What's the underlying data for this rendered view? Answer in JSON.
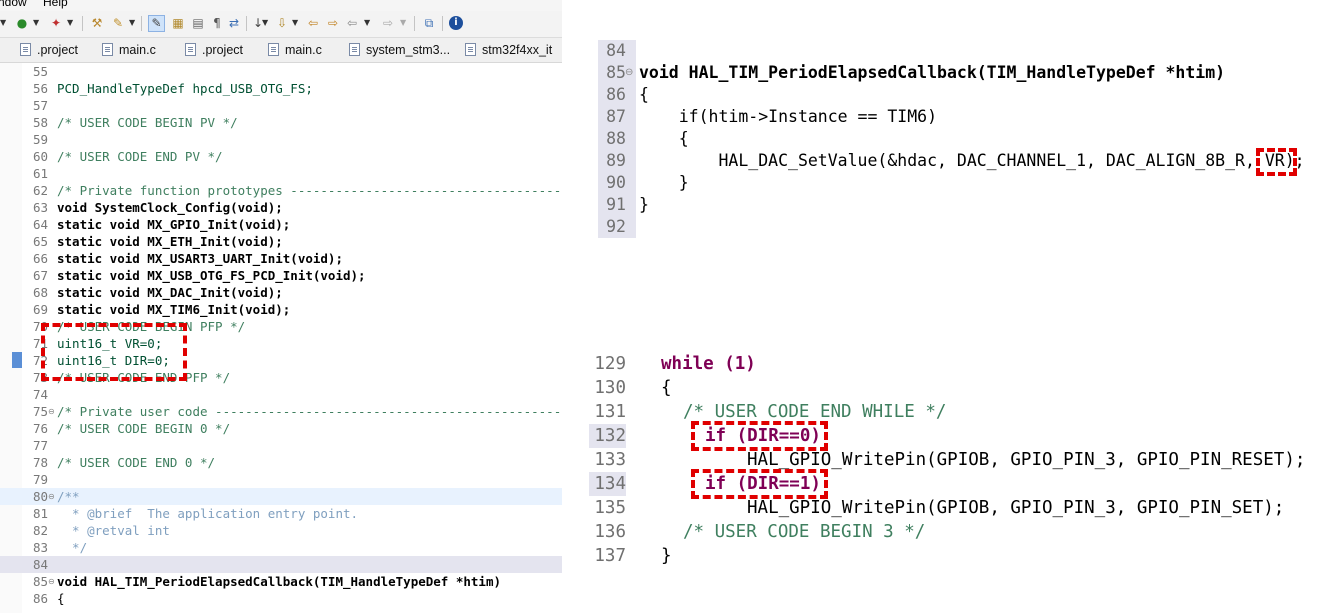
{
  "menubar": {
    "items": [
      "ndow",
      "Help"
    ]
  },
  "toolbar": {
    "icons": [
      "debug-dropdown-icon",
      "run-icon",
      "external-tools-icon",
      "build-icon",
      "toggle-mark-icon",
      "highlight-icon",
      "block-selection-icon",
      "show-whitespace-icon",
      "next-annotation-icon",
      "previous-annotation-icon",
      "back-icon",
      "forward-icon",
      "open-perspective-icon",
      "info-icon"
    ]
  },
  "tabs": [
    {
      "label": ".project"
    },
    {
      "label": "main.c"
    },
    {
      "label": ".project"
    },
    {
      "label": "main.c"
    },
    {
      "label": "system_stm3..."
    },
    {
      "label": "stm32f4xx_it"
    }
  ],
  "code": {
    "lines": [
      {
        "num": "55",
        "text": ""
      },
      {
        "num": "56",
        "text": "PCD_HandleTypeDef hpcd_USB_OTG_FS;"
      },
      {
        "num": "57",
        "text": ""
      },
      {
        "num": "58",
        "text": "/* USER CODE BEGIN PV */"
      },
      {
        "num": "59",
        "text": ""
      },
      {
        "num": "60",
        "text": "/* USER CODE END PV */"
      },
      {
        "num": "61",
        "text": ""
      },
      {
        "num": "62",
        "text": "/* Private function prototypes -----------------------------------------------"
      },
      {
        "num": "63",
        "text": "void SystemClock_Config(void);"
      },
      {
        "num": "64",
        "text": "static void MX_GPIO_Init(void);"
      },
      {
        "num": "65",
        "text": "static void MX_ETH_Init(void);"
      },
      {
        "num": "66",
        "text": "static void MX_USART3_UART_Init(void);"
      },
      {
        "num": "67",
        "text": "static void MX_USB_OTG_FS_PCD_Init(void);"
      },
      {
        "num": "68",
        "text": "static void MX_DAC_Init(void);"
      },
      {
        "num": "69",
        "text": "static void MX_TIM6_Init(void);"
      },
      {
        "num": "70",
        "text": "/* USER CODE BEGIN PFP */"
      },
      {
        "num": "71",
        "text": "uint16_t VR=0;"
      },
      {
        "num": "72",
        "text": "uint16_t DIR=0;"
      },
      {
        "num": "73",
        "text": "/* USER CODE END PFP */"
      },
      {
        "num": "74",
        "text": ""
      },
      {
        "num": "75",
        "text": "/* Private user code -----------------------------------------------"
      },
      {
        "num": "76",
        "text": "/* USER CODE BEGIN 0 */"
      },
      {
        "num": "77",
        "text": ""
      },
      {
        "num": "78",
        "text": "/* USER CODE END 0 */"
      },
      {
        "num": "79",
        "text": ""
      },
      {
        "num": "80",
        "text": "/**"
      },
      {
        "num": "81",
        "text": "  * @brief  The application entry point."
      },
      {
        "num": "82",
        "text": "  * @retval int"
      },
      {
        "num": "83",
        "text": "  */"
      },
      {
        "num": "84",
        "text": ""
      },
      {
        "num": "85",
        "text": "void HAL_TIM_PeriodElapsedCallback(TIM_HandleTypeDef *htim)"
      },
      {
        "num": "86",
        "text": "{"
      }
    ]
  },
  "snippet_callback": {
    "lines": [
      {
        "num": "84",
        "text": ""
      },
      {
        "num": "85",
        "text": "void HAL_TIM_PeriodElapsedCallback(TIM_HandleTypeDef *htim)"
      },
      {
        "num": "86",
        "text": "{"
      },
      {
        "num": "87",
        "text": "    if(htim->Instance == TIM6)"
      },
      {
        "num": "88",
        "text": "    {"
      },
      {
        "num": "89",
        "text": "        HAL_DAC_SetValue(&hdac, DAC_CHANNEL_1, DAC_ALIGN_8B_R, VR);"
      },
      {
        "num": "90",
        "text": "    }"
      },
      {
        "num": "91",
        "text": "}"
      },
      {
        "num": "92",
        "text": ""
      }
    ]
  },
  "snippet_while": {
    "lines": [
      {
        "num": "129",
        "text": "while (1)"
      },
      {
        "num": "130",
        "text": "{"
      },
      {
        "num": "131",
        "text": "/* USER CODE END WHILE */"
      },
      {
        "num": "132",
        "text": "if (DIR==0)"
      },
      {
        "num": "133",
        "text": "HAL_GPIO_WritePin(GPIOB, GPIO_PIN_3, GPIO_PIN_RESET);"
      },
      {
        "num": "134",
        "text": "if (DIR==1)"
      },
      {
        "num": "135",
        "text": "HAL_GPIO_WritePin(GPIOB, GPIO_PIN_3, GPIO_PIN_SET);"
      },
      {
        "num": "136",
        "text": "/* USER CODE BEGIN 3 */"
      },
      {
        "num": "137",
        "text": "}"
      }
    ]
  },
  "colors": {
    "annotation": "#e00000",
    "keyword": "#7f0055",
    "comment": "#3f7f5f",
    "type": "#005032",
    "constant": "#0000c0"
  }
}
